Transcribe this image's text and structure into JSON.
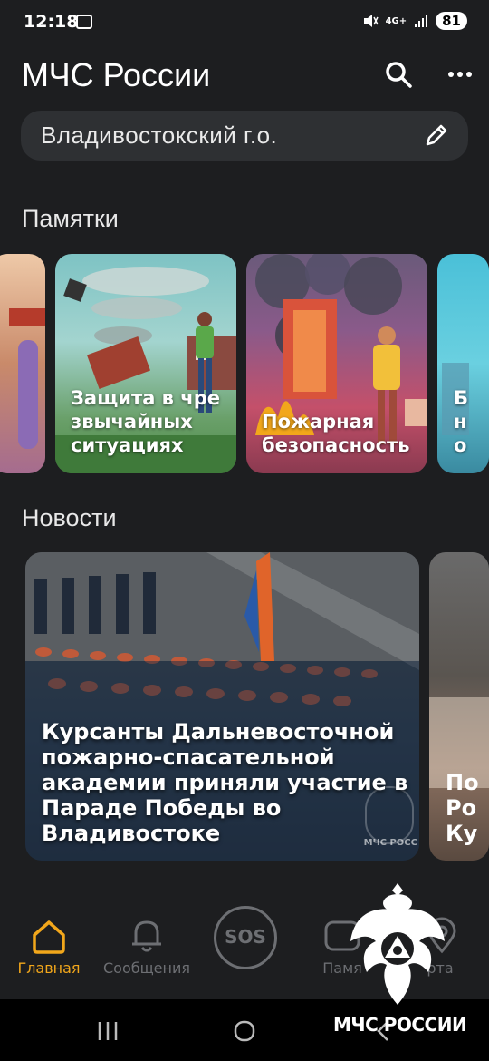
{
  "status_bar": {
    "time": "12:18",
    "network": "4G+",
    "battery": "81"
  },
  "header": {
    "title": "МЧС России"
  },
  "region": {
    "name": "Владивостокский г.о."
  },
  "memos": {
    "section_title": "Памятки",
    "cards": [
      {
        "label": "Защита в чре\nзвычайных\nситуациях"
      },
      {
        "label": "Пожарная\nбезопасность"
      },
      {
        "label": "Б\nн\nо"
      }
    ]
  },
  "news": {
    "section_title": "Новости",
    "items": [
      {
        "title": "Курсанты Дальневосточной пожарно-спасательной академии приняли участие в Параде Победы во Владивостоке",
        "watermark": "МЧС РОСС"
      },
      {
        "title": "По\nРо\nКу"
      }
    ]
  },
  "bottom_nav": {
    "items": [
      {
        "label": "Главная"
      },
      {
        "label": "Сообщения"
      },
      {
        "label": "SOS"
      },
      {
        "label": "Памя"
      },
      {
        "label": "рта"
      }
    ],
    "accent": "#f2a71b"
  },
  "overlay": {
    "emblem_text": "МЧС РОССИИ"
  }
}
